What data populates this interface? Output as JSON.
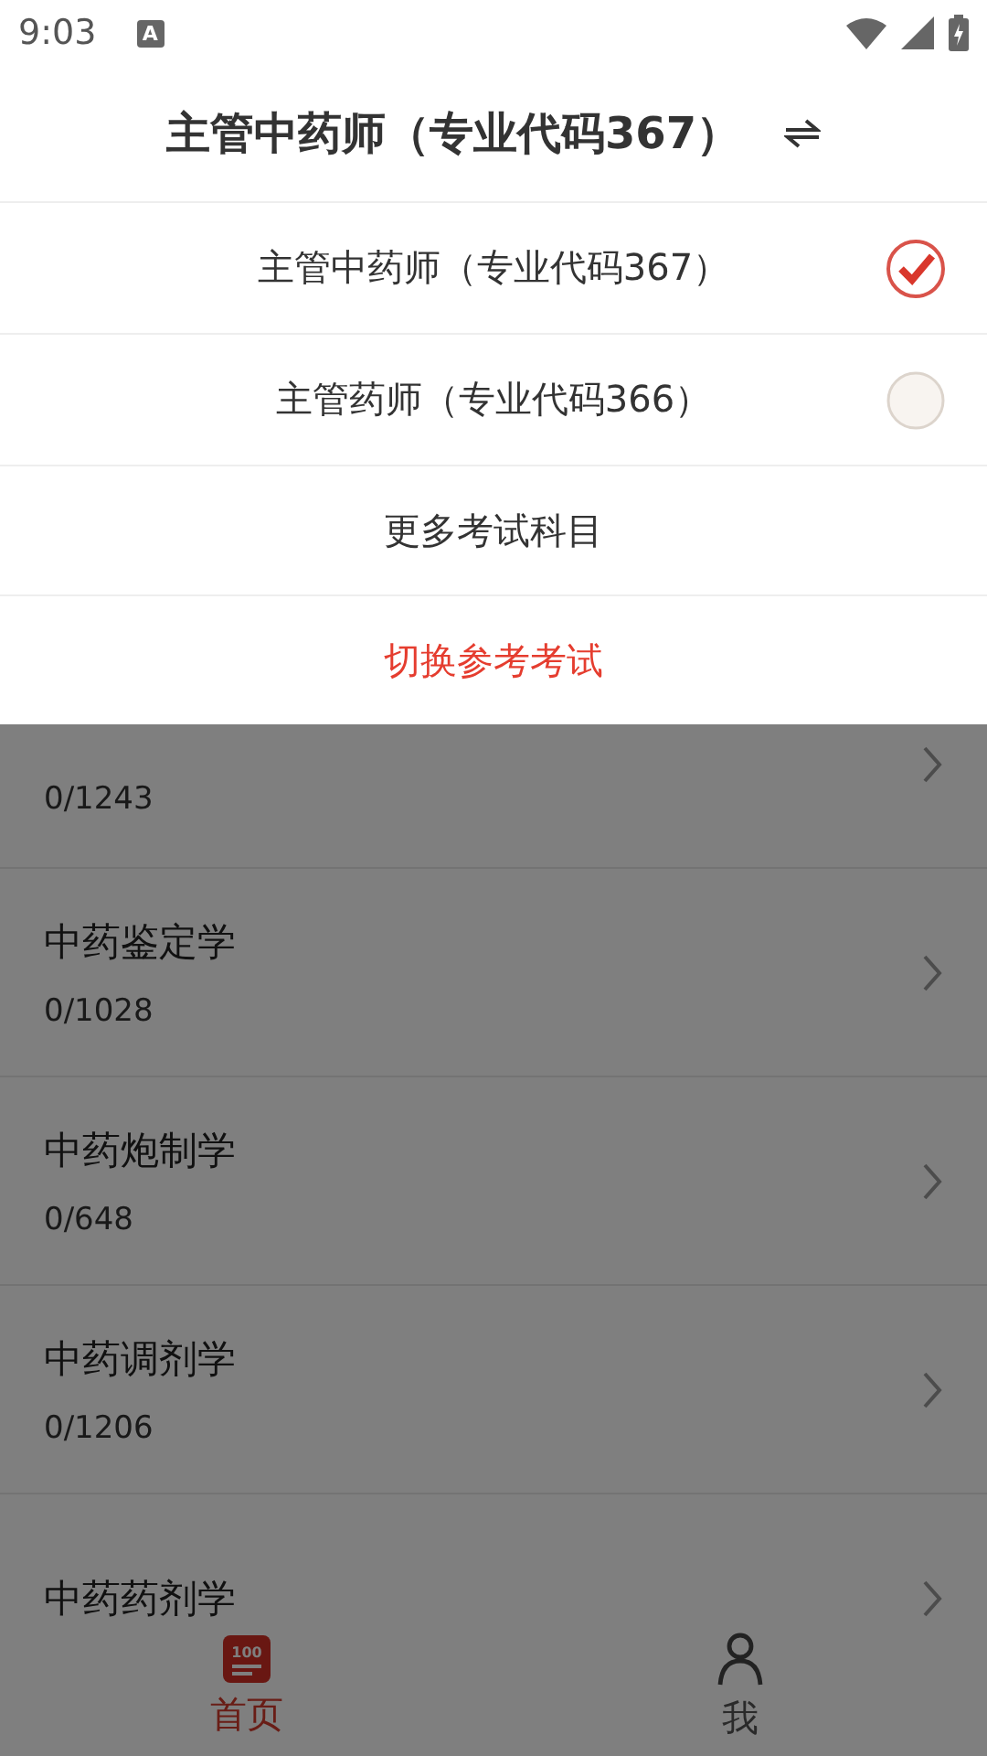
{
  "status_bar": {
    "time": "9:03",
    "notification_glyph": "A"
  },
  "sheet": {
    "title": "主管中药师（专业代码367）",
    "options": [
      {
        "label": "主管中药师（专业代码367）",
        "selected": true
      },
      {
        "label": "主管药师（专业代码366）",
        "selected": false
      }
    ],
    "more": "更多考试科目",
    "confirm": "切换参考考试"
  },
  "subjects": [
    {
      "progress": "0/1243"
    },
    {
      "name": "中药鉴定学",
      "progress": "0/1028"
    },
    {
      "name": "中药炮制学",
      "progress": "0/648"
    },
    {
      "name": "中药调剂学",
      "progress": "0/1206"
    },
    {
      "name": "中药药剂学"
    }
  ],
  "bottom_nav": [
    {
      "kind": "home",
      "label": "首页",
      "icon_text": "100",
      "selected": true
    },
    {
      "kind": "me",
      "label": "我",
      "selected": false
    }
  ]
}
